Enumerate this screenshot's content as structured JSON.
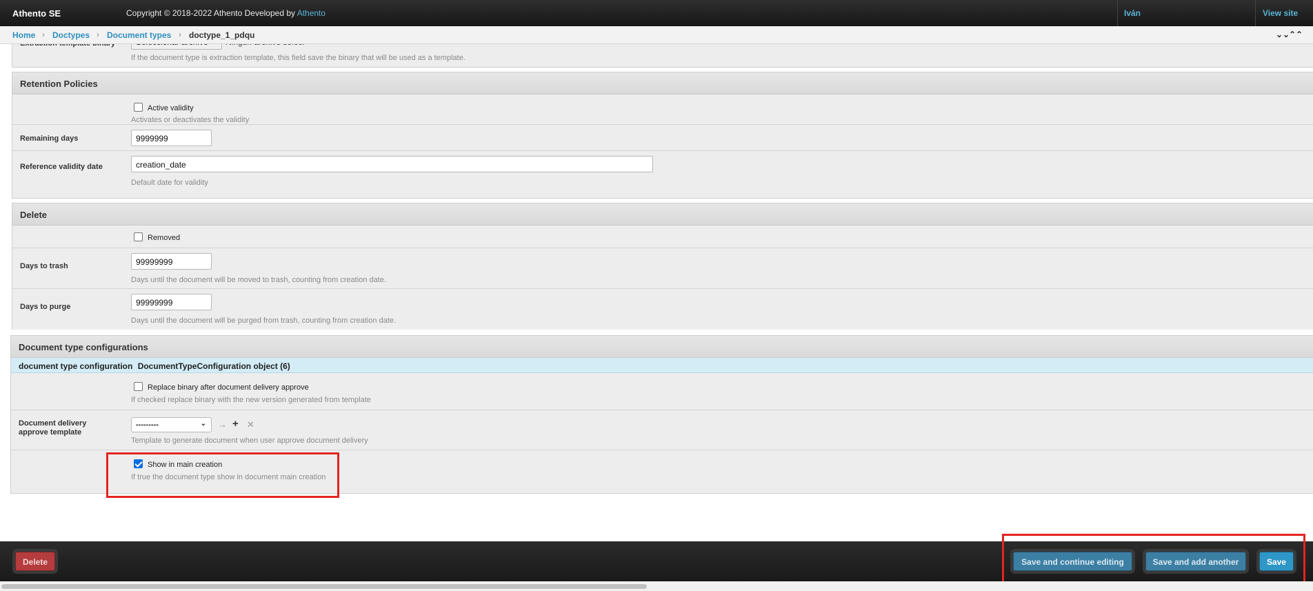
{
  "header": {
    "brand": "Athento SE",
    "copyright_text": "Copyright © 2018-2022 Athento Developed by",
    "copyright_link": "Athento",
    "user": "Iván",
    "view_site": "View site"
  },
  "breadcrumbs": {
    "items": [
      "Home",
      "Doctypes",
      "Document types"
    ],
    "current": "doctype_1_pdqu",
    "separator": "›"
  },
  "extraction": {
    "label": "Extraction template binary",
    "file_button": "Seleccionar archivo",
    "file_status": "Ningún archivo selec.",
    "help": "If the document type is extraction template, this field save the binary that will be used as a template."
  },
  "retention": {
    "title": "Retention Policies",
    "active_validity_label": "Active validity",
    "active_validity_checked": false,
    "active_validity_help": "Activates or deactivates the validity",
    "remaining_days_label": "Remaining days",
    "remaining_days_value": "9999999",
    "reference_date_label": "Reference validity date",
    "reference_date_value": "creation_date",
    "reference_date_help": "Default date for validity"
  },
  "delete_section": {
    "title": "Delete",
    "removed_label": "Removed",
    "removed_checked": false,
    "days_to_trash_label": "Days to trash",
    "days_to_trash_value": "99999999",
    "days_to_trash_help": "Days until the document will be moved to trash, counting from creation date.",
    "days_to_purge_label": "Days to purge",
    "days_to_purge_value": "99999999",
    "days_to_purge_help": "Days until the document will be purged from trash, counting from creation date."
  },
  "doctype_config": {
    "title": "Document type configurations",
    "inline_label": "document type configuration",
    "inline_object": "DocumentTypeConfiguration object (6)",
    "replace_binary_label": "Replace binary after document delivery approve",
    "replace_binary_checked": false,
    "replace_binary_help": "If checked replace binary with the new version generated from template",
    "approve_template_label": "Document delivery approve template",
    "approve_template_value": "---------",
    "approve_template_help": "Template to generate document when user approve document delivery",
    "show_main_label": "Show in main creation",
    "show_main_checked": true,
    "show_main_help": "If true the document type show in document main creation"
  },
  "submit": {
    "delete": "Delete",
    "save_continue": "Save and continue editing",
    "save_add": "Save and add another",
    "save": "Save"
  },
  "colors": {
    "accent": "#2e8fbf",
    "highlight": "#e52420",
    "danger": "#b53c3c"
  }
}
